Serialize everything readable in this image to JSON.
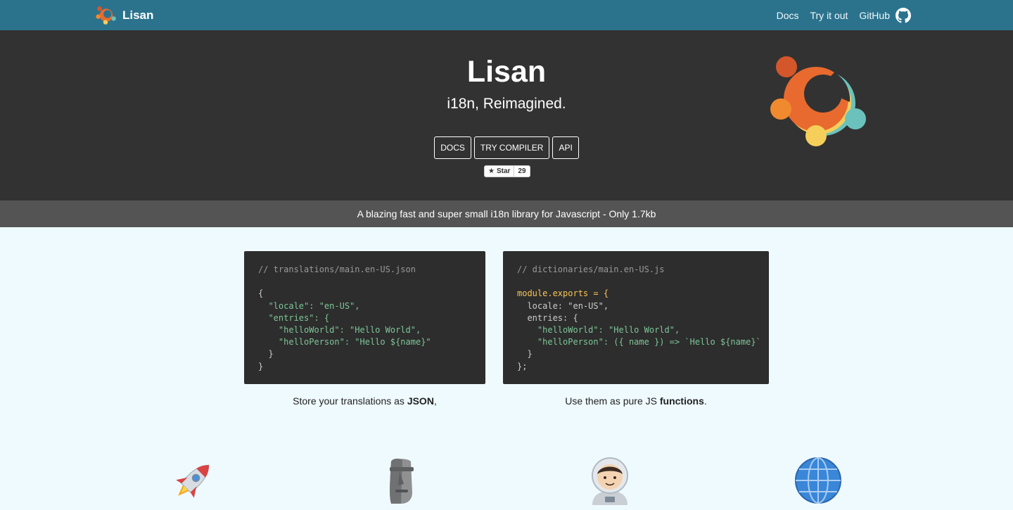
{
  "navbar": {
    "brand": "Lisan",
    "links": [
      "Docs",
      "Try it out",
      "GitHub"
    ]
  },
  "hero": {
    "title": "Lisan",
    "subtitle": "i18n, Reimagined.",
    "buttons": [
      "DOCS",
      "TRY COMPILER",
      "API"
    ],
    "star_label": "Star",
    "star_count": "29"
  },
  "tagline": "A blazing fast and super small i18n library for Javascript - Only 1.7kb",
  "examples": {
    "json": {
      "lines": [
        "// translations/main.en-US.json",
        "",
        "{",
        "  \"locale\": \"en-US\",",
        "  \"entries\": {",
        "    \"helloWorld\": \"Hello World\",",
        "    \"helloPerson\": \"Hello ${name}\"",
        "  }",
        "}"
      ],
      "caption_pre": "Store your translations as ",
      "caption_bold": "JSON",
      "caption_post": ","
    },
    "js": {
      "lines": [
        "// dictionaries/main.en-US.js",
        "",
        "module.exports = {",
        "  locale: \"en-US\",",
        "  entries: {",
        "    \"helloWorld\": \"Hello World\",",
        "    \"helloPerson\": ({ name }) => `Hello ${name}`",
        "  }",
        "};"
      ],
      "caption_pre": "Use them as pure JS ",
      "caption_bold": "functions",
      "caption_post": "."
    }
  },
  "features": [
    "rocket-icon",
    "moai-icon",
    "astronaut-icon",
    "globe-icon"
  ],
  "colors": {
    "navbar": "#2b738d",
    "hero": "#323232",
    "tagline_bar": "#545454",
    "page": "#effaff",
    "code_bg": "#2d2d2d"
  }
}
